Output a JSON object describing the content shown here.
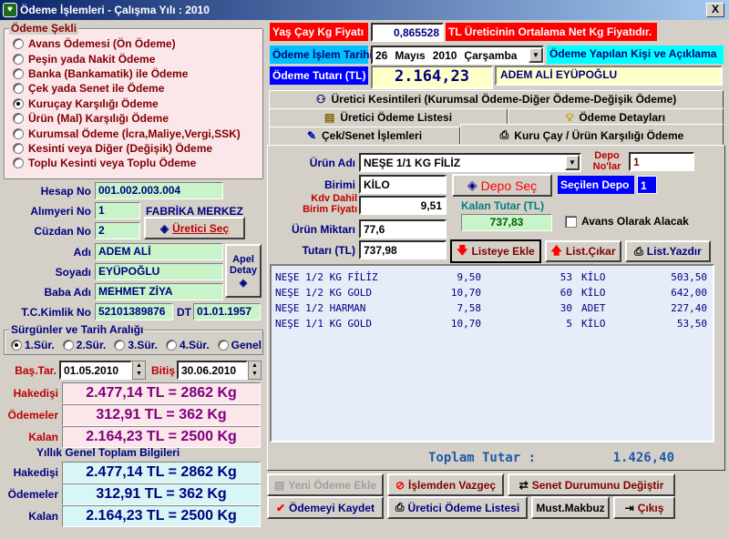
{
  "window": {
    "title": "Ödeme İşlemleri - Çalışma Yılı : 2010",
    "close": "X"
  },
  "odeme_sekli": {
    "legend": "Ödeme Şekli",
    "options": [
      "Avans Ödemesi (Ön Ödeme)",
      "Peşin yada Nakit Ödeme",
      "Banka (Bankamatik) ile Ödeme",
      "Çek yada Senet ile Ödeme",
      "Kuruçay Karşılığı Ödeme",
      "Ürün (Mal) Karşılığı Ödeme",
      "Kurumsal Ödeme (İcra,Maliye,Vergi,SSK)",
      "Kesinti veya Diğer (Değişik) Ödeme",
      "Toplu Kesinti veya Toplu Ödeme"
    ],
    "selected": 4
  },
  "producer": {
    "hesap_no_label": "Hesap No",
    "hesap_no": "001.002.003.004",
    "alim_yeri_label": "Alımyeri No",
    "alim_yeri": "1",
    "alim_yeri_name": "FABRİKA MERKEZ",
    "cuzdan_label": "Cüzdan No",
    "cuzdan": "2",
    "uretici_sec": "Üretici Seç",
    "adi_label": "Adı",
    "adi": "ADEM ALİ",
    "soyadi_label": "Soyadı",
    "soyadi": "EYÜPOĞLU",
    "baba_label": "Baba Adı",
    "baba": "MEHMET ZİYA",
    "tc_label": "T.C.Kimlik No",
    "tc": "52101389876",
    "dt_label": "DT",
    "dt": "01.01.1957",
    "apel_label": "Apel Detay"
  },
  "surgun": {
    "legend": "Sürgünler ve Tarih Aralığı",
    "options": [
      "1.Sür.",
      "2.Sür.",
      "3.Sür.",
      "4.Sür.",
      "Genel"
    ],
    "selected": 0,
    "bas_label": "Baş.Tar.",
    "bas": "01.05.2010",
    "bitis_label": "Bitiş",
    "bitis": "30.06.2010"
  },
  "sums": {
    "hakedis_label": "Hakedişi",
    "hakedis": "2.477,14 TL = 2862 Kg",
    "odemeler_label": "Ödemeler",
    "odemeler": "312,91 TL = 362 Kg",
    "kalan_label": "Kalan",
    "kalan": "2.164,23 TL = 2500 Kg"
  },
  "yillik": {
    "title": "Yıllık Genel Toplam Bilgileri",
    "hakedis": "2.477,14 TL = 2862 Kg",
    "odemeler": "312,91 TL = 362 Kg",
    "kalan": "2.164,23 TL = 2500 Kg"
  },
  "top": {
    "yas_cay_label": "Yaş Çay Kg Fiyatı",
    "yas_cay": "0,865528",
    "yas_cay_note": "TL Üreticinin Ortalama Net Kg Fiyatıdır.",
    "tarih_label": "Ödeme İşlem Tarihi",
    "tarih_day": "26",
    "tarih_month": "Mayıs",
    "tarih_year": "2010",
    "tarih_dow": "Çarşamba",
    "kisi_label": "Ödeme Yapılan Kişi ve Açıklama",
    "tutar_label": "Ödeme Tutarı (TL)",
    "tutar": "2.164,23",
    "kisi": "ADEM ALİ EYÜPOĞLU"
  },
  "tabs": {
    "t1": "Üretici Kesintileri (Kurumsal Ödeme-Diğer Ödeme-Değişik Ödeme)",
    "t2": "Üretici Ödeme Listesi",
    "t3": "Ödeme Detayları",
    "t4": "Çek/Senet İşlemleri",
    "t5": "Kuru Çay / Ürün Karşılığı Ödeme"
  },
  "product": {
    "urun_label": "Ürün Adı",
    "urun": "NEŞE 1/1 KG FİLİZ",
    "depo_no_label": "Depo No'lar",
    "depo_no": "1",
    "birim_label": "Birimi",
    "birim": "KİLO",
    "depo_sec": "Depo Seç",
    "secilen_depo_label": "Seçilen Depo",
    "secilen_depo": "1",
    "kdv_label": "Kdv Dahil Birim Fiyatı",
    "kdv": "9,51",
    "kalan_tutar_label": "Kalan Tutar (TL)",
    "kalan_tutar": "737,83",
    "miktar_label": "Ürün Miktarı",
    "miktar": "77,6",
    "avans_label": "Avans Olarak Alacak",
    "tutar_label": "Tutarı (TL)",
    "tutar": "737,98",
    "listeye_ekle": "Listeye Ekle",
    "list_cikar": "List.Çıkar",
    "list_yazdir": "List.Yazdır"
  },
  "items": [
    {
      "name": "NEŞE 1/2 KG FİLİZ",
      "price": "9,50",
      "qty": "53",
      "unit": "KİLO",
      "total": "503,50"
    },
    {
      "name": "NEŞE 1/2 KG GOLD",
      "price": "10,70",
      "qty": "60",
      "unit": "KİLO",
      "total": "642,00"
    },
    {
      "name": "NEŞE 1/2 HARMAN",
      "price": "7,58",
      "qty": "30",
      "unit": "ADET",
      "total": "227,40"
    },
    {
      "name": "NEŞE 1/1 KG GOLD",
      "price": "10,70",
      "qty": "5",
      "unit": "KİLO",
      "total": "53,50"
    }
  ],
  "total": {
    "label": "Toplam Tutar :",
    "value": "1.426,40"
  },
  "actions": {
    "yeni": "Yeni Ödeme Ekle",
    "vazgec": "İşlemden Vazgeç",
    "senet": "Senet Durumunu Değiştir",
    "kaydet": "Ödemeyi Kaydet",
    "liste": "Üretici Ödeme Listesi",
    "makbuz": "Must.Makbuz",
    "cikis": "Çıkış"
  }
}
